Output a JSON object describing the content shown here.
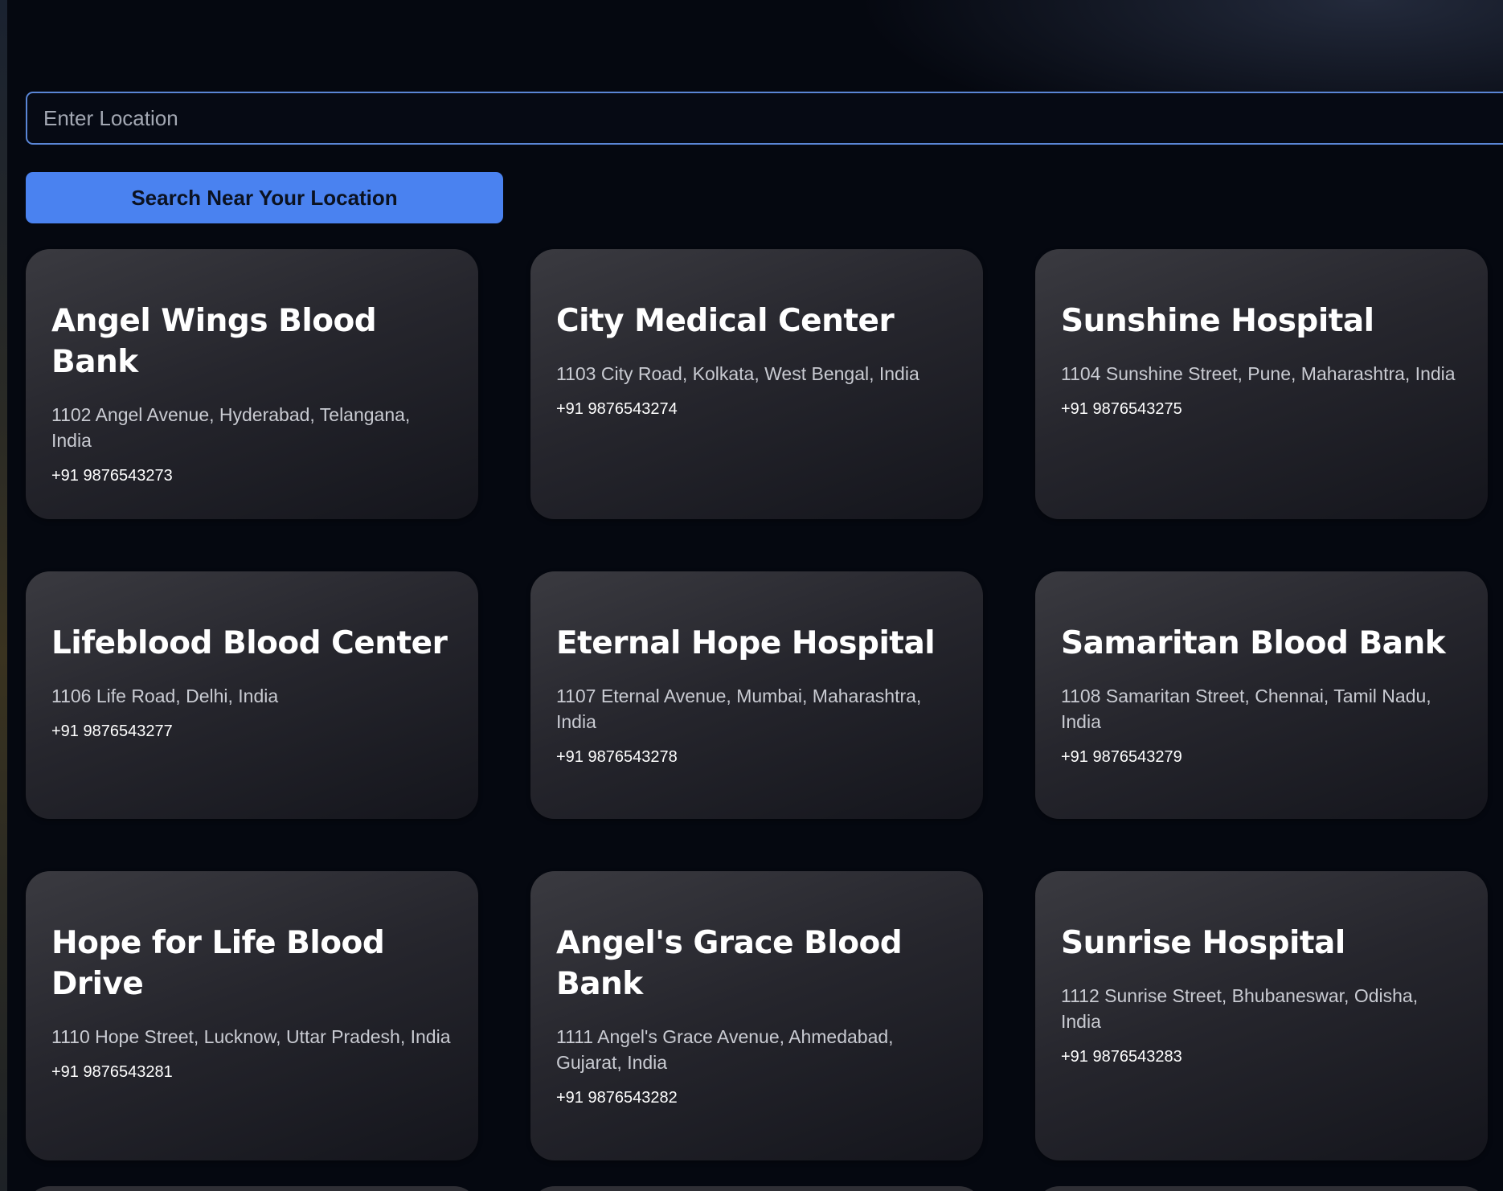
{
  "search": {
    "placeholder": "Enter Location",
    "value": "",
    "button_label": "Search Near Your Location"
  },
  "cards": [
    {
      "name": "Angel Wings Blood Bank",
      "address": "1102 Angel Avenue, Hyderabad, Telangana, India",
      "phone": "+91 9876543273"
    },
    {
      "name": "City Medical Center",
      "address": "1103 City Road, Kolkata, West Bengal, India",
      "phone": "+91 9876543274"
    },
    {
      "name": "Sunshine Hospital",
      "address": "1104 Sunshine Street, Pune, Maharashtra, India",
      "phone": "+91 9876543275"
    },
    {
      "name": "Lifeblood Blood Center",
      "address": "1106 Life Road, Delhi, India",
      "phone": "+91 9876543277"
    },
    {
      "name": "Eternal Hope Hospital",
      "address": "1107 Eternal Avenue, Mumbai, Maharashtra, India",
      "phone": "+91 9876543278"
    },
    {
      "name": "Samaritan Blood Bank",
      "address": "1108 Samaritan Street, Chennai, Tamil Nadu, India",
      "phone": "+91 9876543279"
    },
    {
      "name": "Hope for Life Blood Drive",
      "address": "1110 Hope Street, Lucknow, Uttar Pradesh, India",
      "phone": "+91 9876543281"
    },
    {
      "name": "Angel's Grace Blood Bank",
      "address": "1111 Angel's Grace Avenue, Ahmedabad, Gujarat, India",
      "phone": "+91 9876543282"
    },
    {
      "name": "Sunrise Hospital",
      "address": "1112 Sunrise Street, Bhubaneswar, Odisha, India",
      "phone": "+91 9876543283"
    }
  ],
  "colors": {
    "background": "#050810",
    "accent": "#4a82f0",
    "input_border": "#5a86d6",
    "card_top": "#3a3a40",
    "card_bottom": "#14151c"
  }
}
